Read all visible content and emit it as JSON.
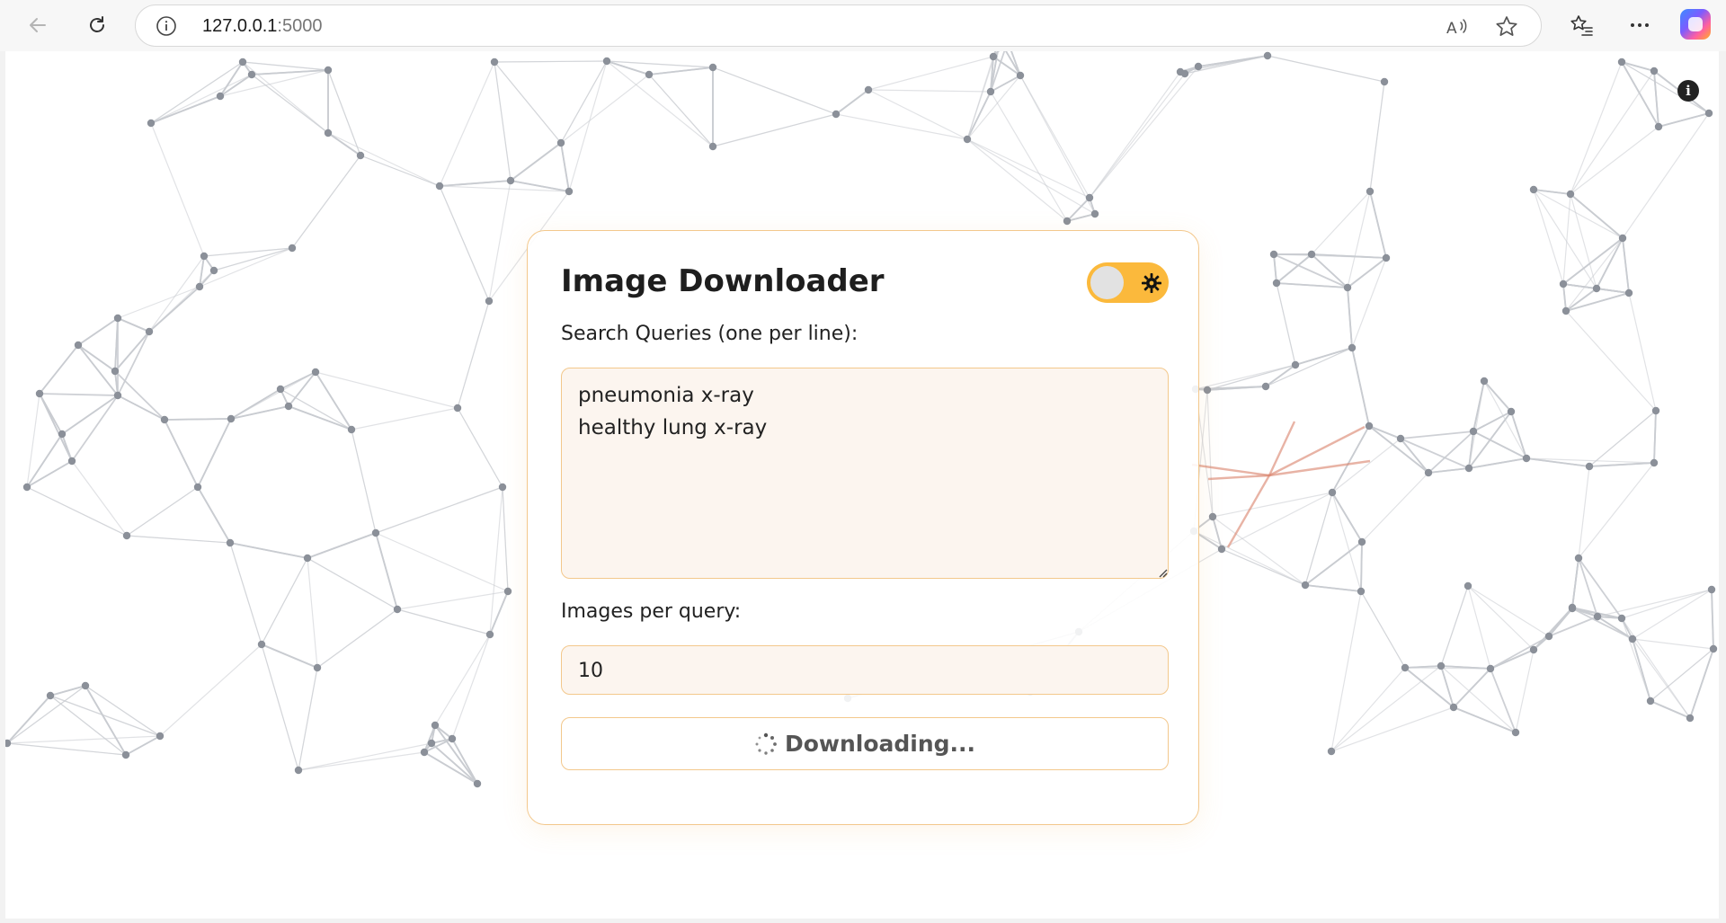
{
  "browser": {
    "address_host": "127.0.0.1",
    "address_port": ":5000",
    "icons": [
      "back-arrow-icon",
      "refresh-icon",
      "site-info-icon",
      "read-aloud-icon",
      "favorite-star-icon",
      "favorites-list-icon",
      "more-menu-icon",
      "copilot-icon"
    ]
  },
  "app": {
    "title": "Image Downloader",
    "theme_toggle_icon": "sun-gear-icon",
    "info_icon_glyph": "i",
    "queries_label": "Search Queries (one per line):",
    "queries_value": "pneumonia x-ray\nhealthy lung x-ray",
    "images_per_query_label": "Images per query:",
    "images_per_query_value": "10",
    "download_button_label": "Downloading...",
    "download_button_icon": "spinner-icon"
  },
  "colors": {
    "accent": "#fbb93c",
    "card_border": "#f3c88c",
    "input_bg": "#fcf5ef",
    "network_lines": "#c9ccd1",
    "network_nodes": "#8b9099",
    "network_highlight": "#d9826b"
  }
}
